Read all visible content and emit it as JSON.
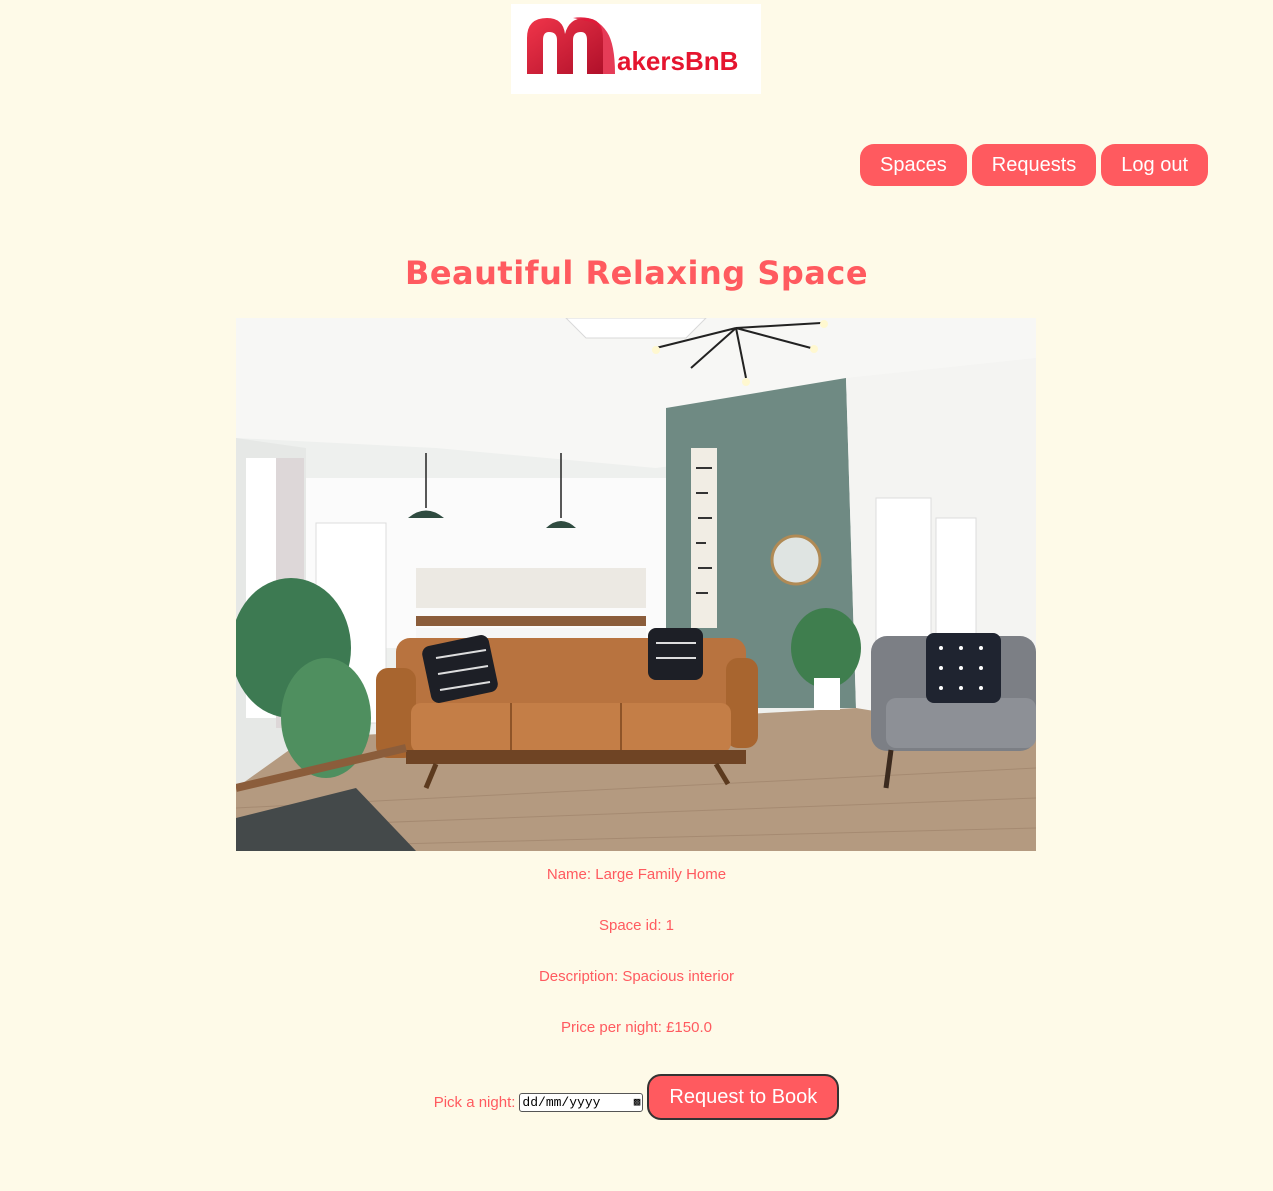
{
  "logo": {
    "brand": "MakersBnB",
    "rest_text": "akersBnB"
  },
  "nav": {
    "spaces": "Spaces",
    "requests": "Requests",
    "logout": "Log out"
  },
  "space": {
    "title": "Beautiful Relaxing Space",
    "name_line": "Name: Large Family Home",
    "id_line": "Space id: 1",
    "description_line": "Description: Spacious interior",
    "price_line": "Price per night: £150.0"
  },
  "booking": {
    "pick_label": "Pick a night:",
    "date_placeholder": "dd/mm/yyyy",
    "submit_label": "Request to Book"
  },
  "colors": {
    "background": "#fefae8",
    "accent": "#ff5a5f"
  }
}
